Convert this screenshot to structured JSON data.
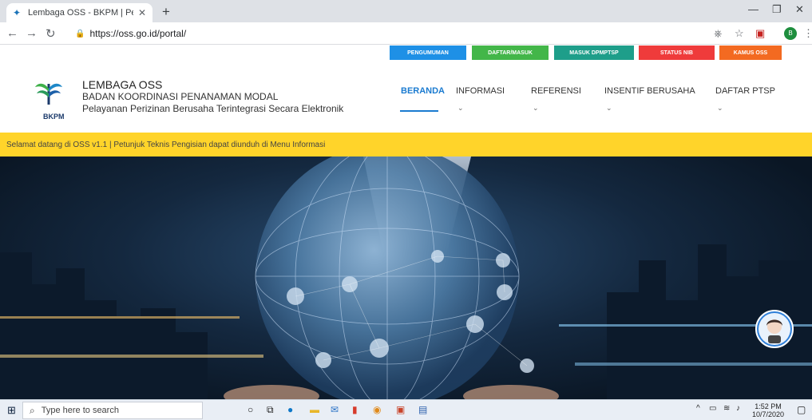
{
  "browser": {
    "tab_title": "Lembaga OSS - BKPM | Pelayana",
    "url": "https://oss.go.id/portal/",
    "profile_initial": "B"
  },
  "top_buttons": [
    {
      "label": "PENGUMUMAN",
      "color": "#1e90e6"
    },
    {
      "label": "DAFTAR/MASUK",
      "color": "#43b649"
    },
    {
      "label": "MASUK DPMPTSP",
      "color": "#1e9e8a"
    },
    {
      "label": "STATUS NIB",
      "color": "#ef3b3b"
    },
    {
      "label": "KAMUS OSS",
      "color": "#f36a21"
    }
  ],
  "header": {
    "logo_text": "BKPM",
    "title": "LEMBAGA OSS",
    "subtitle1": "BADAN KOORDINASI PENANAMAN MODAL",
    "subtitle2": "Pelayanan Perizinan Berusaha Terintegrasi Secara Elektronik"
  },
  "nav": [
    {
      "label": "BERANDA",
      "active": true
    },
    {
      "label": "INFORMASI",
      "active": false
    },
    {
      "label": "REFERENSI",
      "active": false
    },
    {
      "label": "INSENTIF BERUSAHA",
      "active": false
    },
    {
      "label": "DAFTAR PTSP",
      "active": false
    }
  ],
  "marquee": "Selamat datang di OSS v1.1 | Petunjuk Teknis Pengisian dapat diunduh di Menu Informasi",
  "taskbar": {
    "search_placeholder": "Type here to search",
    "time": "1:52 PM",
    "date": "10/7/2020"
  },
  "colors": {
    "accent": "#1b7bd0",
    "marquee_bg": "#ffd42a"
  }
}
